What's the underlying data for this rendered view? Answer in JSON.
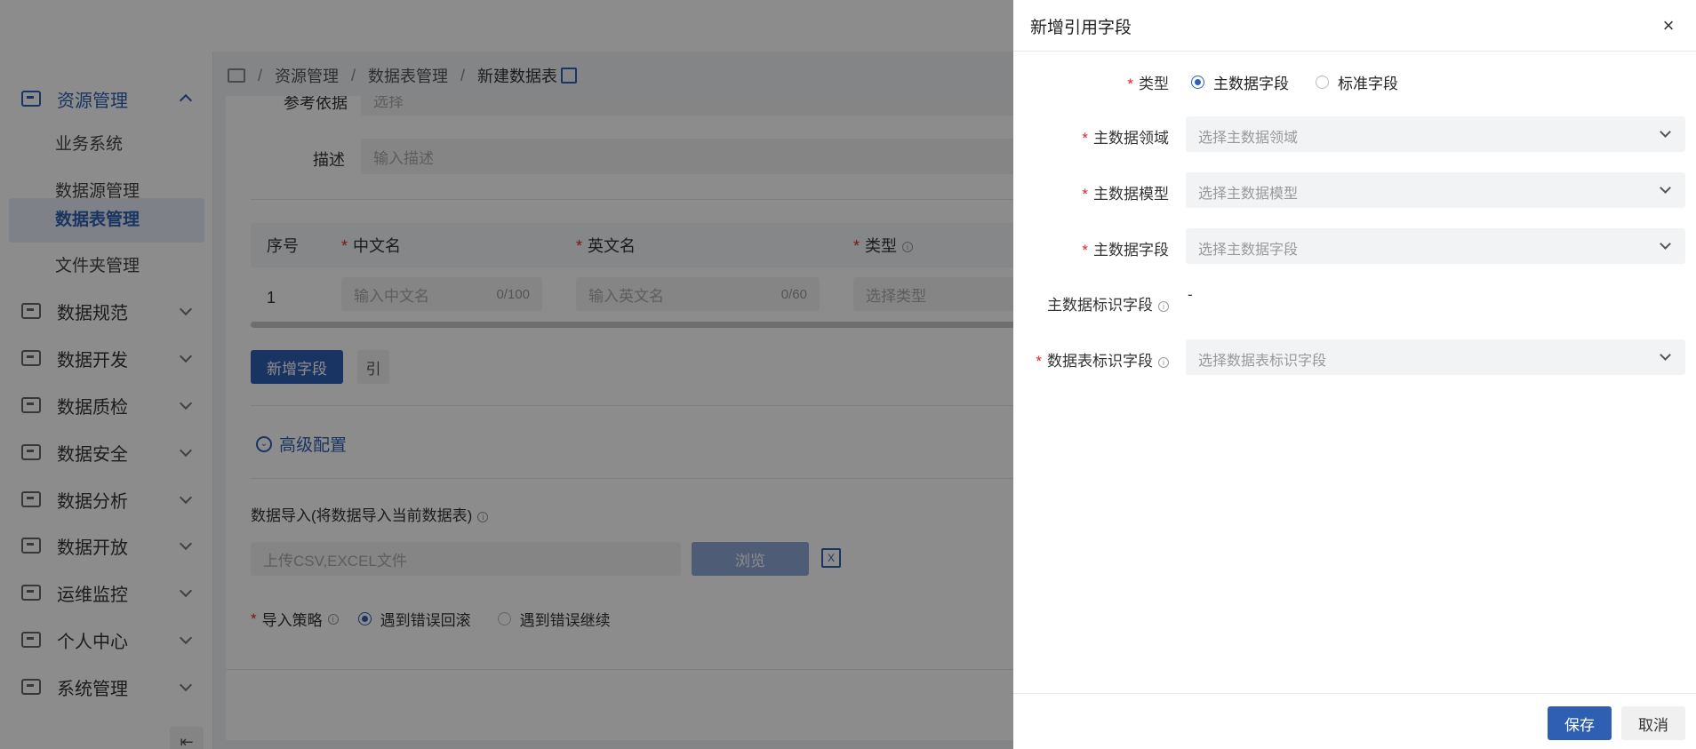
{
  "sidebar": {
    "groups": [
      {
        "label": "资源管理",
        "icon": "resource-icon"
      },
      {
        "label": "数据规范",
        "icon": "standard-icon"
      },
      {
        "label": "数据开发",
        "icon": "develop-icon"
      },
      {
        "label": "数据质检",
        "icon": "quality-icon"
      },
      {
        "label": "数据安全",
        "icon": "security-icon"
      },
      {
        "label": "数据分析",
        "icon": "analysis-icon"
      },
      {
        "label": "数据开放",
        "icon": "open-icon"
      },
      {
        "label": "运维监控",
        "icon": "monitor-icon"
      },
      {
        "label": "个人中心",
        "icon": "user-icon"
      },
      {
        "label": "系统管理",
        "icon": "system-icon"
      }
    ],
    "sub_items": [
      {
        "label": "业务系统"
      },
      {
        "label": "数据源管理"
      },
      {
        "label": "数据表管理"
      },
      {
        "label": "文件夹管理"
      }
    ],
    "collapse_icon": "⇤"
  },
  "breadcrumb": {
    "items": [
      "资源管理",
      "数据表管理",
      "新建数据表"
    ],
    "separator": "/"
  },
  "form": {
    "ref_label": "参考依据",
    "ref_placeholder": "选择",
    "desc_label": "描述",
    "desc_placeholder": "输入描述",
    "table": {
      "col_index": "序号",
      "col_cn": "中文名",
      "col_en": "英文名",
      "col_type": "类型",
      "row_index": "1",
      "cn_placeholder": "输入中文名",
      "cn_count": "0/100",
      "en_placeholder": "输入英文名",
      "en_count": "0/60",
      "type_placeholder": "选择类型"
    },
    "add_field_btn": "新增字段",
    "ref_btn": "引",
    "advanced_label": "高级配置",
    "import_label": "数据导入(将数据导入当前数据表)",
    "upload_placeholder": "上传CSV,EXCEL文件",
    "browse_btn": "浏览",
    "strategy_label": "导入策略",
    "strategy_opt1": "遇到错误回滚",
    "strategy_opt2": "遇到错误继续"
  },
  "drawer": {
    "title": "新增引用字段",
    "close": "×",
    "type_label": "类型",
    "type_options": [
      "主数据字段",
      "标准字段"
    ],
    "domain_label": "主数据领域",
    "domain_placeholder": "选择主数据领域",
    "model_label": "主数据模型",
    "model_placeholder": "选择主数据模型",
    "field_label": "主数据字段",
    "field_placeholder": "选择主数据字段",
    "id_field_label": "主数据标识字段",
    "id_field_value": "-",
    "table_id_label": "数据表标识字段",
    "table_id_placeholder": "选择数据表标识字段",
    "save_btn": "保存",
    "cancel_btn": "取消"
  },
  "colors": {
    "primary": "#2f5fb3",
    "required": "#e02424",
    "mask": "rgba(0,0,0,0.45)"
  }
}
